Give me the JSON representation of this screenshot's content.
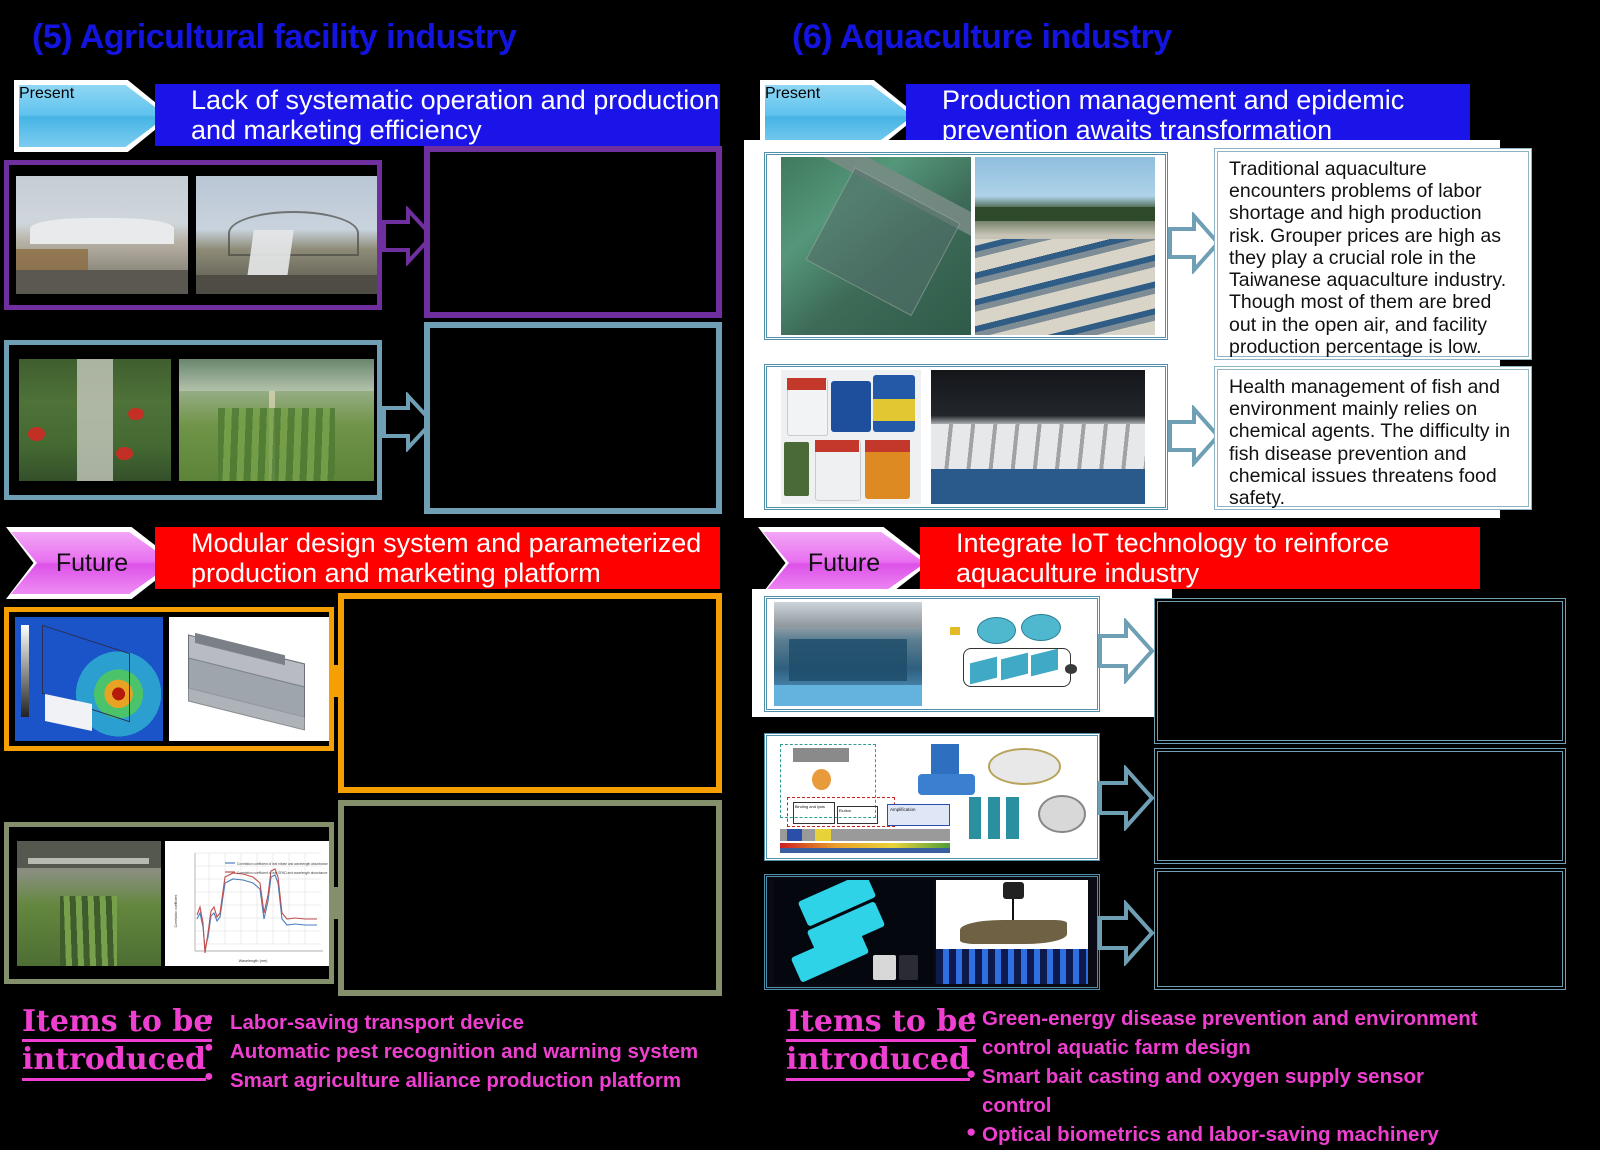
{
  "left": {
    "title": "(5) Agricultural facility industry",
    "present": {
      "tag": "Present",
      "text": "Lack of systematic operation and production and marketing efficiency"
    },
    "future": {
      "tag": "Future",
      "text": "Modular design system and parameterized production and marketing platform"
    },
    "items": {
      "label_line1": "Items to be",
      "label_line2": "introduced",
      "list": [
        "Labor-saving transport device",
        "Automatic pest recognition and warning system",
        "Smart agriculture alliance production platform"
      ]
    }
  },
  "right": {
    "title": "(6) Aquaculture industry",
    "present": {
      "tag": "Present",
      "text": "Production management and epidemic prevention awaits transformation"
    },
    "future": {
      "tag": "Future",
      "text": "Integrate IoT technology to reinforce aquaculture industry"
    },
    "info_boxes": [
      "Traditional aquaculture encounters problems of labor shortage and high production risk. Grouper prices are high as they play a crucial role in the Taiwanese aquaculture industry. Though most of them are bred out in the open air, and facility production percentage is low.",
      "Health management of fish and environment mainly relies on chemical agents. The difficulty in fish disease prevention and chemical issues threatens food safety."
    ],
    "items": {
      "label_line1": "Items to be",
      "label_line2": "introduced",
      "list": [
        "Green-energy disease prevention and environment control aquatic farm design",
        "Smart bait casting and oxygen supply sensor control",
        "Optical biometrics and labor-saving machinery"
      ]
    }
  },
  "colors": {
    "title_blue": "#1414e0",
    "present_bar": "#1a14e8",
    "future_bar": "#ff0000",
    "present_tag": "#5fc3ee",
    "future_tag": "#dd52e8",
    "purple_frame": "#6f2f9f",
    "steel_frame": "#6f9fb5",
    "orange_frame": "#f59f02",
    "olive_frame": "#83906b",
    "magenta_text": "#ef3fd0",
    "background": "#000000"
  },
  "chart_thumb": {
    "title": "",
    "xlabel": "Wavelength (nm)",
    "ylabel": "Correlation coefficient",
    "legend": [
      "Correlation coefficient of leaf nitrate and wavelength absorbance",
      "Correlation coefficient of leaf SPAD and wavelength absorbance"
    ]
  }
}
